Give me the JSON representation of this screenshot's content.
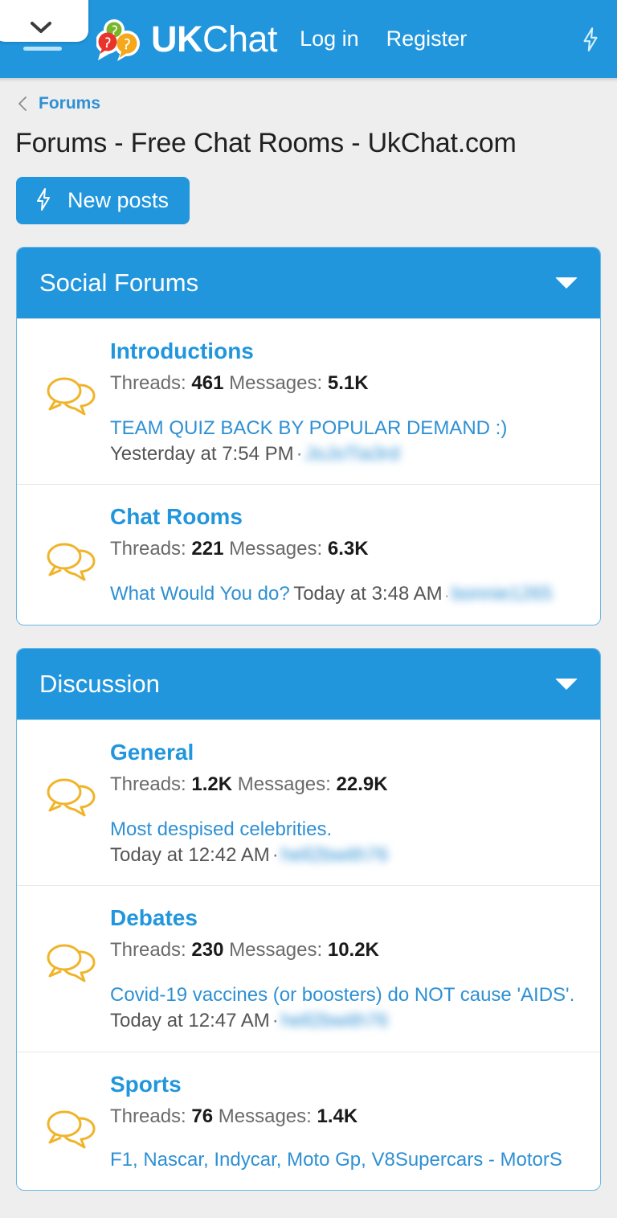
{
  "browser": {
    "chevron_icon": "chevron-down-icon"
  },
  "header": {
    "brand_bold": "UK",
    "brand_light": "Chat",
    "logo_icon": "ukchat-speech-bubbles-logo",
    "login_label": "Log in",
    "register_label": "Register",
    "bolt_icon": "lightning-bolt-icon"
  },
  "breadcrumb": {
    "back_icon": "chevron-left-icon",
    "label": "Forums"
  },
  "page": {
    "title": "Forums - Free Chat Rooms - UkChat.com",
    "new_posts_label": "New posts",
    "new_posts_icon": "lightning-bolt-icon"
  },
  "colors": {
    "brand_blue": "#2196dd",
    "link_blue": "#2e90d4",
    "icon_amber": "#f0b429",
    "page_bg": "#eeeeee",
    "card_border": "#6ab8e4"
  },
  "sections": [
    {
      "title": "Social Forums",
      "caret_icon": "caret-down-icon",
      "forums": [
        {
          "name": "Introductions",
          "icon": "speech-bubbles-icon",
          "threads_label": "Threads:",
          "threads_value": "461",
          "messages_label": "Messages:",
          "messages_value": "5.1K",
          "latest_layout": "stacked",
          "latest_title": "TEAM QUIZ BACK BY POPULAR DEMAND :)",
          "latest_time": "Yesterday at 7:54 PM",
          "latest_user": "JoJoTia3rd",
          "user_blurred": true
        },
        {
          "name": "Chat Rooms",
          "icon": "speech-bubbles-icon",
          "threads_label": "Threads:",
          "threads_value": "221",
          "messages_label": "Messages:",
          "messages_value": "6.3K",
          "latest_layout": "inline",
          "latest_title": "What Would You do?",
          "latest_time": "Today at 3:48 AM",
          "latest_user": "bonnie1265",
          "user_blurred": true
        }
      ]
    },
    {
      "title": "Discussion",
      "caret_icon": "caret-down-icon",
      "forums": [
        {
          "name": "General",
          "icon": "speech-bubbles-icon",
          "threads_label": "Threads:",
          "threads_value": "1.2K",
          "messages_label": "Messages:",
          "messages_value": "22.9K",
          "latest_layout": "stacked",
          "latest_title": "Most despised celebrities.",
          "latest_time": "Today at 12:42 AM",
          "latest_user": "hell2bwith76",
          "user_blurred": true
        },
        {
          "name": "Debates",
          "icon": "speech-bubbles-icon",
          "threads_label": "Threads:",
          "threads_value": "230",
          "messages_label": "Messages:",
          "messages_value": "10.2K",
          "latest_layout": "stacked",
          "latest_title": "Covid-19 vaccines (or boosters) do NOT cause 'AIDS'.",
          "latest_time": "Today at 12:47 AM",
          "latest_user": "hell2bwith76",
          "user_blurred": true
        },
        {
          "name": "Sports",
          "icon": "speech-bubbles-icon",
          "threads_label": "Threads:",
          "threads_value": "76",
          "messages_label": "Messages:",
          "messages_value": "1.4K",
          "latest_layout": "stacked",
          "latest_title": "F1, Nascar, Indycar, Moto Gp, V8Supercars - MotorS",
          "latest_time": "",
          "latest_user": "",
          "user_blurred": false,
          "truncated": true
        }
      ]
    }
  ]
}
